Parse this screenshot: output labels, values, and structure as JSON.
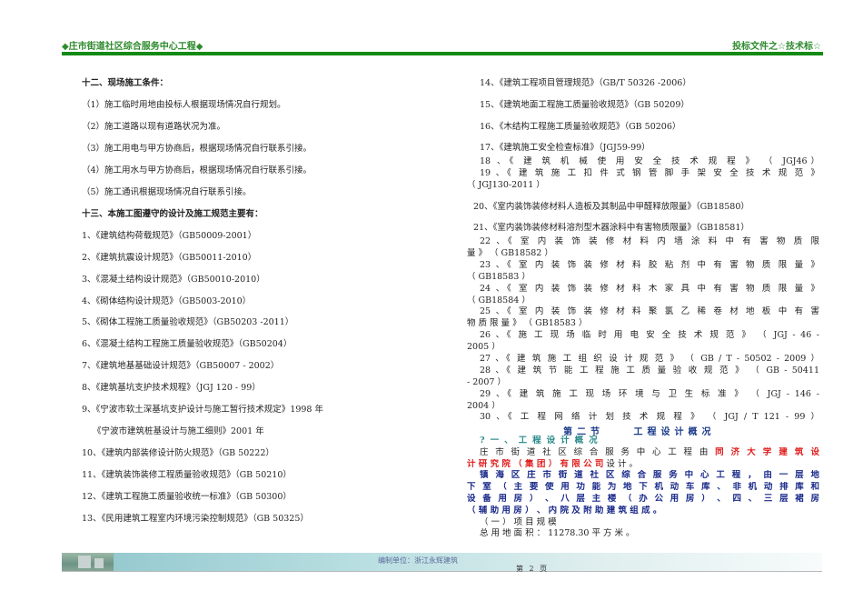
{
  "header": {
    "left": "◆庄市街道社区综合服务中心工程◆",
    "right": "投标文件之☆技术标☆"
  },
  "left": [
    "十二、现场施工条件：",
    "（1）施工临时用地由投标人根据现场情况自行规划。",
    "（2）施工道路以现有道路状况为准。",
    "（3）施工用电与甲方协商后，根据现场情况自行联系引接。",
    "（4）施工用水与甲方协商后，根据现场情况自行联系引接。",
    "（5）施工通讯根据现场情况自行联系引接。",
    "十三、本施工图遵守的设计及施工规范主要有：",
    "1、《建筑结构荷载规范》（GB50009-2001）",
    "2、《建筑抗震设计规范》（GB50011-2010）",
    "3、《混凝土结构设计规范》（GB50010-2010）",
    "4、《砌体结构设计规范》（GB5003-2010）",
    "5、《砌体工程施工质量验收规范》（GB50203 -2011）",
    "6、《混凝土结构工程施工质量验收规范》（GB50204）",
    "7、《建筑地基基础设计规范》（GB50007 - 2002）",
    "8、《建筑基坑支护技术规程》（JGJ 120 - 99）",
    "9、《宁波市软土深基坑支护设计与施工暂行技术规定》1998 年",
    "《宁波市建筑桩基设计与施工细则》2001 年",
    "10、《建筑内部装修设计防火规范》（GB 50222）",
    "11、《建筑装饰装修工程质量验收规范》（GB 50210）",
    "12、《建筑工程施工质量验收统一标准》（GB 50300）",
    "13、《民用建筑工程室内环境污染控制规范》（GB 50325）"
  ],
  "right_simple": [
    "14、《建筑工程项目管理规范》（GB/T 50326 -2006）",
    "15、《建筑地面工程施工质量验收规范》（GB 50209）",
    "16、《木结构工程施工质量验收规范》（GB 50206）",
    "17、《建筑施工安全检查标准》（JGJ59-99）",
    "20、《室内装饰装修材料人造板及其制品中甲醛释放限量》（GB18580）",
    "21、《室内装饰装修材料溶剂型木器涂料中有害物质限量》（GB18581）"
  ],
  "right_wrapped": [
    {
      "lines": [
        "18 、《 建 筑 机 械 使 用 安 全 技 术 规 程 》 （ JGJ46）"
      ]
    },
    {
      "lines": [
        "19 、《 建 筑 施 工 扣 件 式 钢 管 脚 手 架 安 全 技 术 规 范 》",
        "（ JGJ130-2011 ）"
      ]
    },
    {
      "lines": [
        "22 、《 室 内 装 饰 装 修 材 料 内 墙 涂 料 中 有 害 物 质 限",
        "量 》 （ GB18582 ）"
      ]
    },
    {
      "lines": [
        "23 、《 室 内 装 饰 装 修 材 料 胶 粘 剂 中 有 害 物 质 限 量 》",
        "（ GB18583 ）"
      ]
    },
    {
      "lines": [
        "24 、《 室 内 装 饰 装 修 材 料 木 家 具 中 有 害 物 质 限 量 》",
        "（ GB18584 ）"
      ]
    },
    {
      "lines": [
        "25 、《 室 内 装 饰 装 修 材 料 聚 氯 乙 稀 卷 材 地 板 中 有 害",
        "物 质 限 量 》 （ GB18583 ）"
      ]
    },
    {
      "lines": [
        "26 、《 施 工 现 场 临 时 用 电 安 全 技 术 规 范 》 （ JGJ - 46 -",
        "2005 ）"
      ]
    },
    {
      "lines": [
        "27 、《 建 筑 施 工 组 织 设 计 规 范 》 （ GB / T - 50502 - 2009 ）"
      ]
    },
    {
      "lines": [
        "28 、《 建 筑 节 能 工 程 施 工 质 量 验 收 规 范 》 （ GB - 50411",
        "- 2007 ）"
      ]
    },
    {
      "lines": [
        "29 、《 建 筑 施 工 现 场 环 境 与 卫 生 标 准 》 （ JGJ - 146 -",
        "2004 ）"
      ]
    },
    {
      "lines": [
        "30 、《 工 程 网 络 计 划 技 术 规 程 》 （ JGJ / T 121 - 99 ）"
      ]
    }
  ],
  "section": {
    "title": "第二节 工程设计概况",
    "sub": "?一、工程设计概况",
    "p1_a": "庄 市 街 道 社 区 综 合 服 务 中 心 工 程 由",
    "p1_red1": "同 济 大 学 建 筑 设",
    "p1_red2": "计 研 究 院 （ 集 团 ） 有 限 公 司",
    "p1_b": "设 计 。",
    "p2_lines": [
      "镇 海 区 庄 市 街 道 社 区 综 合 服 务 中 心 工 程 ， 由 一 层 地",
      "下 室 （ 主 要 使 用 功 能 为 地 下 机 动 车 库 、 非 机 动 排 库 和",
      "设 备 用 房 ） 、 八 层 主 楼 （ 办 公 用 房 ） 、 四 、 三 层 裙 房",
      "（ 辅 助 用 房 ） 、 内 院 及 附 助 建 筑 组 成 。"
    ],
    "scale_heading": "（ 一 ） 项 目 规 模",
    "area": "总 用 地 面 积 ： 11278.30 平 方 米 。"
  },
  "footer": {
    "unit": "编制单位：浙江永辉建筑",
    "page": "第 2 页"
  }
}
